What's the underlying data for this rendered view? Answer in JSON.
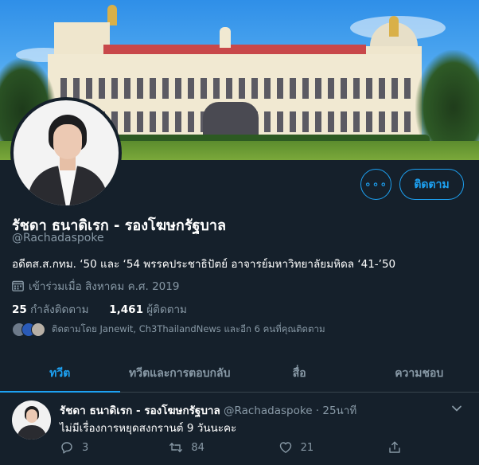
{
  "profile": {
    "name": "รัชดา ธนาดิเรก - รองโฆษกรัฐบาล",
    "handle": "@Rachadaspoke",
    "bio": "อดีตส.ส.กทม. ‘50 และ ‘54 พรรคประชาธิปัตย์ อาจารย์มหาวิทยาลัยมหิดล ‘41-’50",
    "joined": "เข้าร่วมเมื่อ สิงหาคม ค.ศ. 2019",
    "following_count": "25",
    "following_label": "กำลังติดตาม",
    "followers_count": "1,461",
    "followers_label": "ผู้ติดตาม",
    "followed_by": "ติดตามโดย Janewit, Ch3ThailandNews และอีก 6 คนที่คุณติดตาม"
  },
  "buttons": {
    "more_label": "∘∘∘",
    "follow_label": "ติดตาม"
  },
  "tabs": [
    {
      "label": "ทวีต"
    },
    {
      "label": "ทวีตและการตอบกลับ"
    },
    {
      "label": "สื่อ"
    },
    {
      "label": "ความชอบ"
    }
  ],
  "tweet": {
    "author": "รัชดา ธนาดิเรก - รองโฆษกรัฐบาล",
    "meta": "@Rachadaspoke · 25นาที",
    "text": "ไม่มีเรื่องการหยุดสงกรานต์ 9 วันนะคะ",
    "replies": "3",
    "retweets": "84",
    "likes": "21"
  },
  "icons": {
    "more": "more-icon",
    "calendar": "calendar-icon",
    "chevron": "chevron-down-icon",
    "reply": "reply-icon",
    "retweet": "retweet-icon",
    "like": "heart-icon",
    "share": "share-icon"
  },
  "colors": {
    "background": "#15202b",
    "accent": "#1da1f2",
    "muted": "#8899a6",
    "divider": "#38444d"
  }
}
